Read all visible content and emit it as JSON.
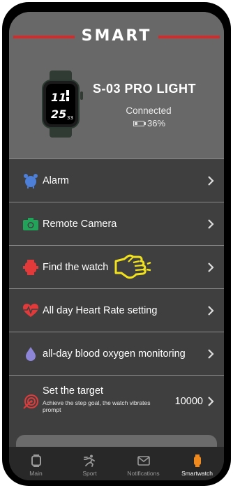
{
  "header": {
    "brand": "SMART",
    "device_name": "S-03 PRO LIGHT",
    "connection_status": "Connected",
    "battery": "36%",
    "watch_time_hours": "11",
    "watch_time_minutes": "25",
    "watch_small": "33"
  },
  "menu": {
    "items": [
      {
        "label": "Alarm",
        "icon": "alarm-clock-icon"
      },
      {
        "label": "Remote Camera",
        "icon": "camera-icon"
      },
      {
        "label": "Find the watch",
        "icon": "watch-icon"
      },
      {
        "label": "All day Heart Rate setting",
        "icon": "heart-rate-icon"
      },
      {
        "label": "all-day blood oxygen monitoring",
        "icon": "droplet-icon"
      }
    ],
    "target": {
      "label": "Set the target",
      "description": "Achieve the step goal, the watch vibrates prompt",
      "value": "10000"
    }
  },
  "tabs": [
    {
      "label": "Main",
      "icon": "watch-icon"
    },
    {
      "label": "Sport",
      "icon": "runner-icon"
    },
    {
      "label": "Notifications",
      "icon": "envelope-icon"
    },
    {
      "label": "Smartwatch",
      "icon": "smartwatch-icon",
      "active": true
    }
  ],
  "colors": {
    "accent_red": "#d42a2a",
    "active_orange": "#f08a1e",
    "header_bg": "#686868",
    "list_bg": "#3f3f3f",
    "pointer_yellow": "#f1e21c"
  }
}
